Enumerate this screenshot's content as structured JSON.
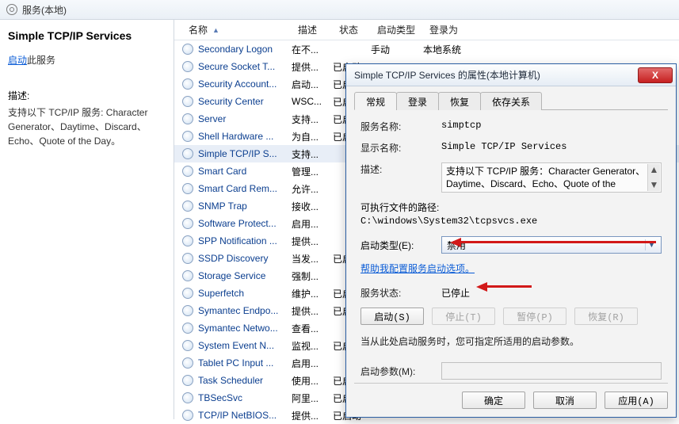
{
  "top": {
    "title": "服务(本地)"
  },
  "left": {
    "selected_service": "Simple TCP/IP Services",
    "start_link": "启动",
    "start_suffix": "此服务",
    "desc_hd": "描述:",
    "desc": "支持以下 TCP/IP 服务: Character Generator、Daytime、Discard、Echo、Quote of the Day。"
  },
  "cols": {
    "name": "名称",
    "desc": "描述",
    "state": "状态",
    "start": "启动类型",
    "logon": "登录为"
  },
  "rows": [
    {
      "name": "Secondary Logon",
      "desc": "在不...",
      "state": "",
      "start": "手动",
      "logon": "本地系统"
    },
    {
      "name": "Secure Socket T...",
      "desc": "提供...",
      "state": "已启动",
      "start": "",
      "logon": ""
    },
    {
      "name": "Security Account...",
      "desc": "启动...",
      "state": "已启动",
      "start": "",
      "logon": ""
    },
    {
      "name": "Security Center",
      "desc": "WSC...",
      "state": "已启动",
      "start": "",
      "logon": ""
    },
    {
      "name": "Server",
      "desc": "支持...",
      "state": "已启动",
      "start": "",
      "logon": ""
    },
    {
      "name": "Shell Hardware ...",
      "desc": "为自...",
      "state": "已启动",
      "start": "",
      "logon": ""
    },
    {
      "name": "Simple TCP/IP S...",
      "desc": "支持...",
      "state": "",
      "start": "",
      "logon": "",
      "sel": true
    },
    {
      "name": "Smart Card",
      "desc": "管理...",
      "state": "",
      "start": "",
      "logon": ""
    },
    {
      "name": "Smart Card Rem...",
      "desc": "允许...",
      "state": "",
      "start": "",
      "logon": ""
    },
    {
      "name": "SNMP Trap",
      "desc": "接收...",
      "state": "",
      "start": "",
      "logon": ""
    },
    {
      "name": "Software Protect...",
      "desc": "启用...",
      "state": "",
      "start": "",
      "logon": ""
    },
    {
      "name": "SPP Notification ...",
      "desc": "提供...",
      "state": "",
      "start": "",
      "logon": ""
    },
    {
      "name": "SSDP Discovery",
      "desc": "当发...",
      "state": "已启动",
      "start": "",
      "logon": ""
    },
    {
      "name": "Storage Service",
      "desc": "强制...",
      "state": "",
      "start": "",
      "logon": ""
    },
    {
      "name": "Superfetch",
      "desc": "维护...",
      "state": "已启动",
      "start": "",
      "logon": ""
    },
    {
      "name": "Symantec Endpo...",
      "desc": "提供...",
      "state": "已启动",
      "start": "",
      "logon": ""
    },
    {
      "name": "Symantec Netwo...",
      "desc": "查看...",
      "state": "",
      "start": "",
      "logon": ""
    },
    {
      "name": "System Event N...",
      "desc": "监视...",
      "state": "已启动",
      "start": "",
      "logon": ""
    },
    {
      "name": "Tablet PC Input ...",
      "desc": "启用...",
      "state": "",
      "start": "",
      "logon": ""
    },
    {
      "name": "Task Scheduler",
      "desc": "使用...",
      "state": "已启动",
      "start": "",
      "logon": ""
    },
    {
      "name": "TBSecSvc",
      "desc": "阿里...",
      "state": "已启动",
      "start": "",
      "logon": ""
    },
    {
      "name": "TCP/IP NetBIOS...",
      "desc": "提供...",
      "state": "已启动",
      "start": "",
      "logon": ""
    }
  ],
  "dlg": {
    "title": "Simple TCP/IP Services 的属性(本地计算机)",
    "close": "X",
    "tabs": {
      "general": "常规",
      "logon": "登录",
      "recovery": "恢复",
      "deps": "依存关系"
    },
    "svc_name_lab": "服务名称:",
    "svc_name": "simptcp",
    "disp_name_lab": "显示名称:",
    "disp_name": "Simple TCP/IP Services",
    "desc_lab": "描述:",
    "desc": "支持以下 TCP/IP 服务：Character Generator、Daytime、Discard、Echo、Quote of the",
    "exe_lab": "可执行文件的路径:",
    "exe": "C:\\windows\\System32\\tcpsvcs.exe",
    "starttype_lab": "启动类型(E):",
    "starttype": "禁用",
    "help": "帮助我配置服务启动选项。",
    "state_lab": "服务状态:",
    "state": "已停止",
    "btn_start": "启动(S)",
    "btn_stop": "停止(T)",
    "btn_pause": "暂停(P)",
    "btn_resume": "恢复(R)",
    "info": "当从此处启动服务时，您可指定所适用的启动参数。",
    "param_lab": "启动参数(M):",
    "ok": "确定",
    "cancel": "取消",
    "apply": "应用(A)"
  }
}
